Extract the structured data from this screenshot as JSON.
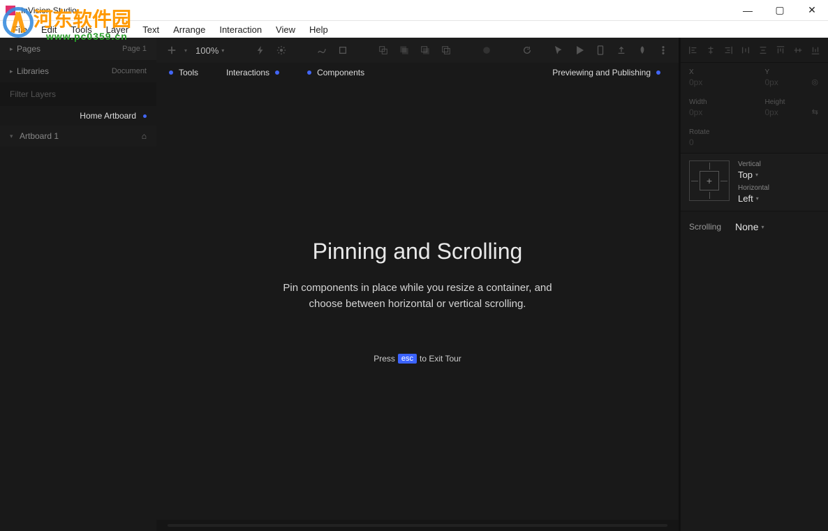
{
  "window": {
    "title": "InVision Studio"
  },
  "menu": {
    "items": [
      "File",
      "Edit",
      "Tools",
      "Layer",
      "Text",
      "Arrange",
      "Interaction",
      "View",
      "Help"
    ]
  },
  "watermark": {
    "line1": "河东软件园",
    "line2": "www.pc0359.cn"
  },
  "toolbar": {
    "zoom": "100%"
  },
  "tour_tabs": {
    "tools": "Tools",
    "interactions": "Interactions",
    "components": "Components",
    "preview": "Previewing and Publishing"
  },
  "left": {
    "pages_label": "Pages",
    "pages_right": "Page 1",
    "libraries_label": "Libraries",
    "libraries_right": "Document",
    "filter_placeholder": "Filter Layers",
    "home_artboard": "Home Artboard",
    "artboard_1": "Artboard 1"
  },
  "tour": {
    "title": "Pinning and Scrolling",
    "body1": "Pin components in place while you resize a container, and",
    "body2": "choose between horizontal or vertical scrolling.",
    "press": "Press",
    "esc": "esc",
    "exit": "to Exit Tour"
  },
  "right": {
    "x_label": "X",
    "x_val": "0px",
    "y_label": "Y",
    "y_val": "0px",
    "w_label": "Width",
    "w_val": "0px",
    "h_label": "Height",
    "h_val": "0px",
    "rotate_label": "Rotate",
    "rotate_val": "0",
    "vertical_label": "Vertical",
    "vertical_val": "Top",
    "horizontal_label": "Horizontal",
    "horizontal_val": "Left",
    "scrolling_label": "Scrolling",
    "scrolling_val": "None"
  }
}
